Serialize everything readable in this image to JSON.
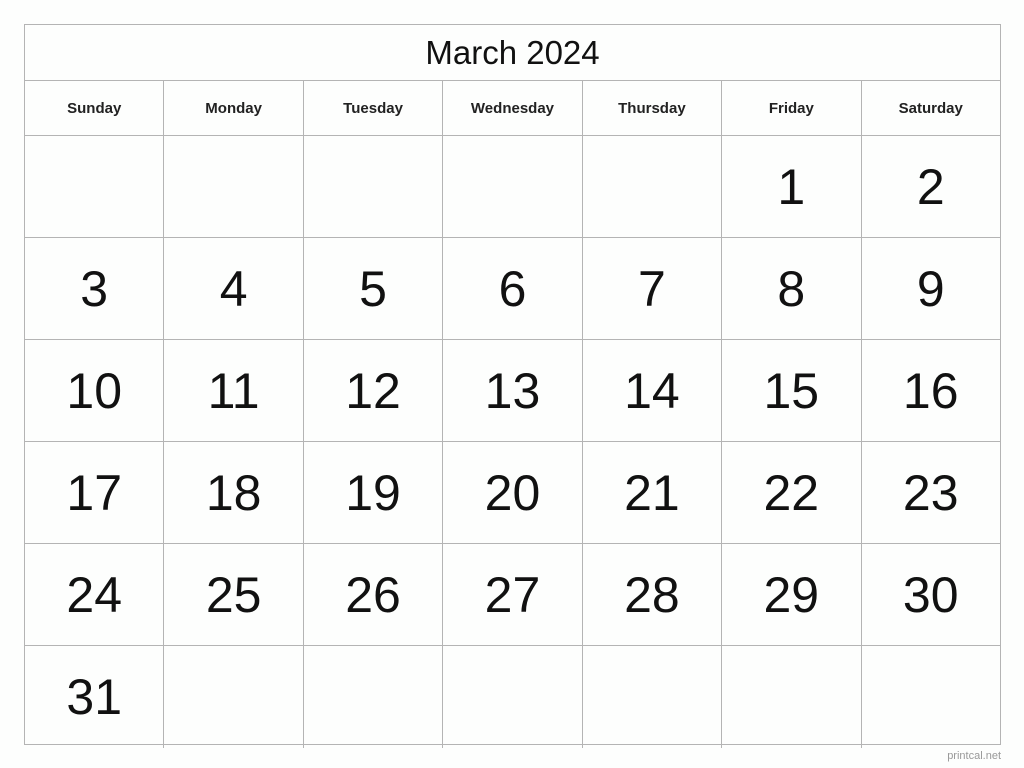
{
  "title": "March 2024",
  "weekdays": [
    "Sunday",
    "Monday",
    "Tuesday",
    "Wednesday",
    "Thursday",
    "Friday",
    "Saturday"
  ],
  "weeks": [
    [
      "",
      "",
      "",
      "",
      "",
      "1",
      "2"
    ],
    [
      "3",
      "4",
      "5",
      "6",
      "7",
      "8",
      "9"
    ],
    [
      "10",
      "11",
      "12",
      "13",
      "14",
      "15",
      "16"
    ],
    [
      "17",
      "18",
      "19",
      "20",
      "21",
      "22",
      "23"
    ],
    [
      "24",
      "25",
      "26",
      "27",
      "28",
      "29",
      "30"
    ],
    [
      "31",
      "",
      "",
      "",
      "",
      "",
      ""
    ]
  ],
  "footer": "printcal.net"
}
